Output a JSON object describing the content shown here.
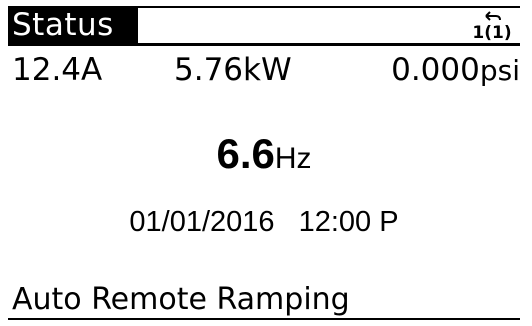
{
  "status_bar": {
    "title": "Status",
    "menu_indicator": "1(1)",
    "menu_icon": "back-arrow-icon"
  },
  "readouts": {
    "current": "12.4A",
    "power": "5.76kW",
    "pressure_value": "0.000",
    "pressure_unit": "psi"
  },
  "main": {
    "frequency_value": "6.6",
    "frequency_unit": "Hz",
    "date": "01/01/2016",
    "time": "12:00 P"
  },
  "bottom": {
    "status_line": "Auto Remote Ramping"
  }
}
